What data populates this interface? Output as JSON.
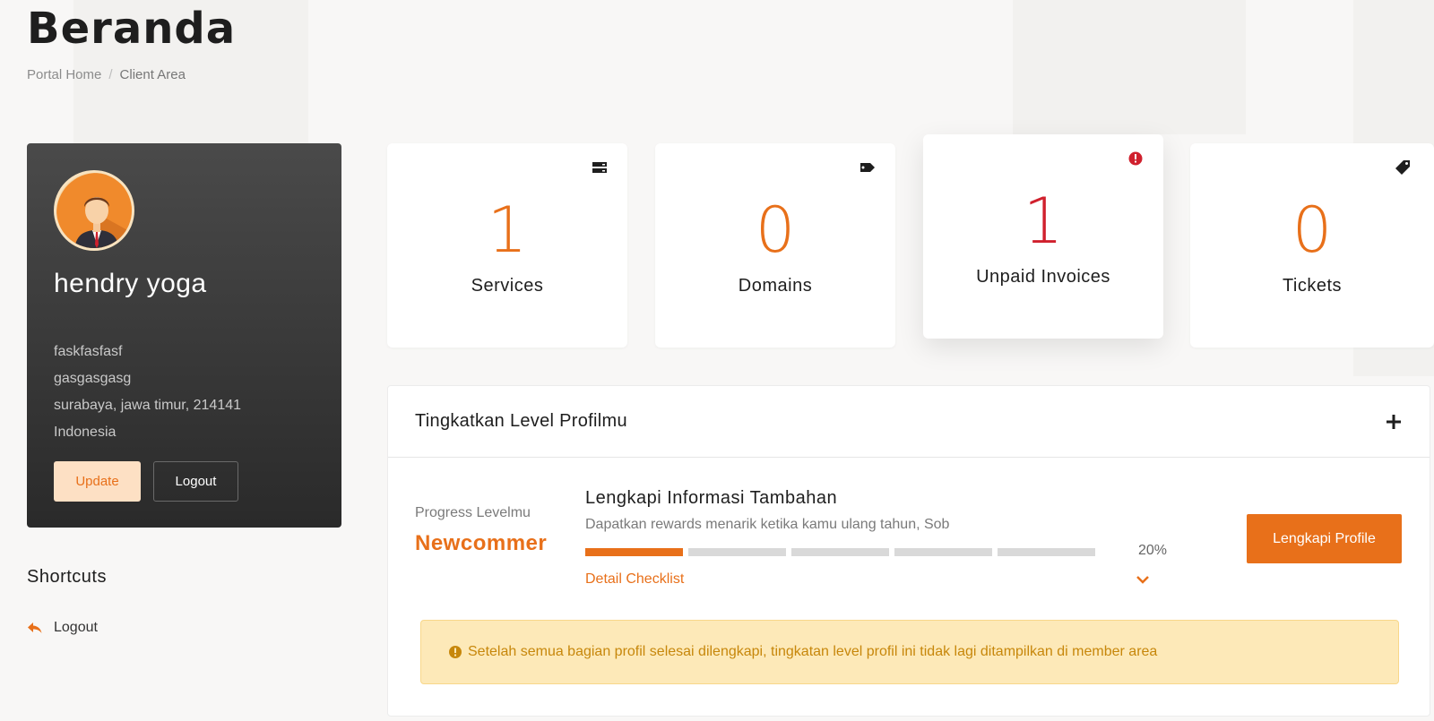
{
  "page": {
    "title": "Beranda"
  },
  "breadcrumb": {
    "home": "Portal Home",
    "separator": "/",
    "current": "Client Area"
  },
  "profile": {
    "name": "hendry yoga",
    "address_lines": [
      "faskfasfasf",
      "gasgasgasg",
      "surabaya, jawa timur, 214141",
      "Indonesia"
    ],
    "update_label": "Update",
    "logout_label": "Logout"
  },
  "shortcuts": {
    "title": "Shortcuts",
    "items": [
      {
        "label": "Logout",
        "icon": "reply-icon"
      }
    ]
  },
  "stats": [
    {
      "value": "1",
      "label": "Services",
      "icon": "server-icon",
      "color": "#e8701a"
    },
    {
      "value": "0",
      "label": "Domains",
      "icon": "tag-icon",
      "color": "#e8701a"
    },
    {
      "value": "1",
      "label": "Unpaid Invoices",
      "icon": "exclamation-circle-icon",
      "color": "#d0202d"
    },
    {
      "value": "0",
      "label": "Tickets",
      "icon": "ticket-icon",
      "color": "#e8701a"
    }
  ],
  "level_panel": {
    "title": "Tingkatkan Level Profilmu",
    "progress_label": "Progress Levelmu",
    "level_name": "Newcommer",
    "task_title": "Lengkapi Informasi Tambahan",
    "task_subtitle": "Dapatkan rewards menarik ketika kamu ulang tahun, Sob",
    "progress_percent": "20%",
    "progress_value": 0.2,
    "segments_total": 5,
    "segments_filled": 1,
    "detail_link": "Detail Checklist",
    "cta_label": "Lengkapi Profile",
    "alert_text": "Setelah semua bagian profil selesai dilengkapi, tingkatan level profil ini tidak lagi ditampilkan di member area"
  },
  "colors": {
    "accent": "#e8701a",
    "danger": "#d0202d",
    "alert_bg": "#fde9b8",
    "alert_text": "#c7870b",
    "sidebar_bg": "#3a3a3a"
  }
}
